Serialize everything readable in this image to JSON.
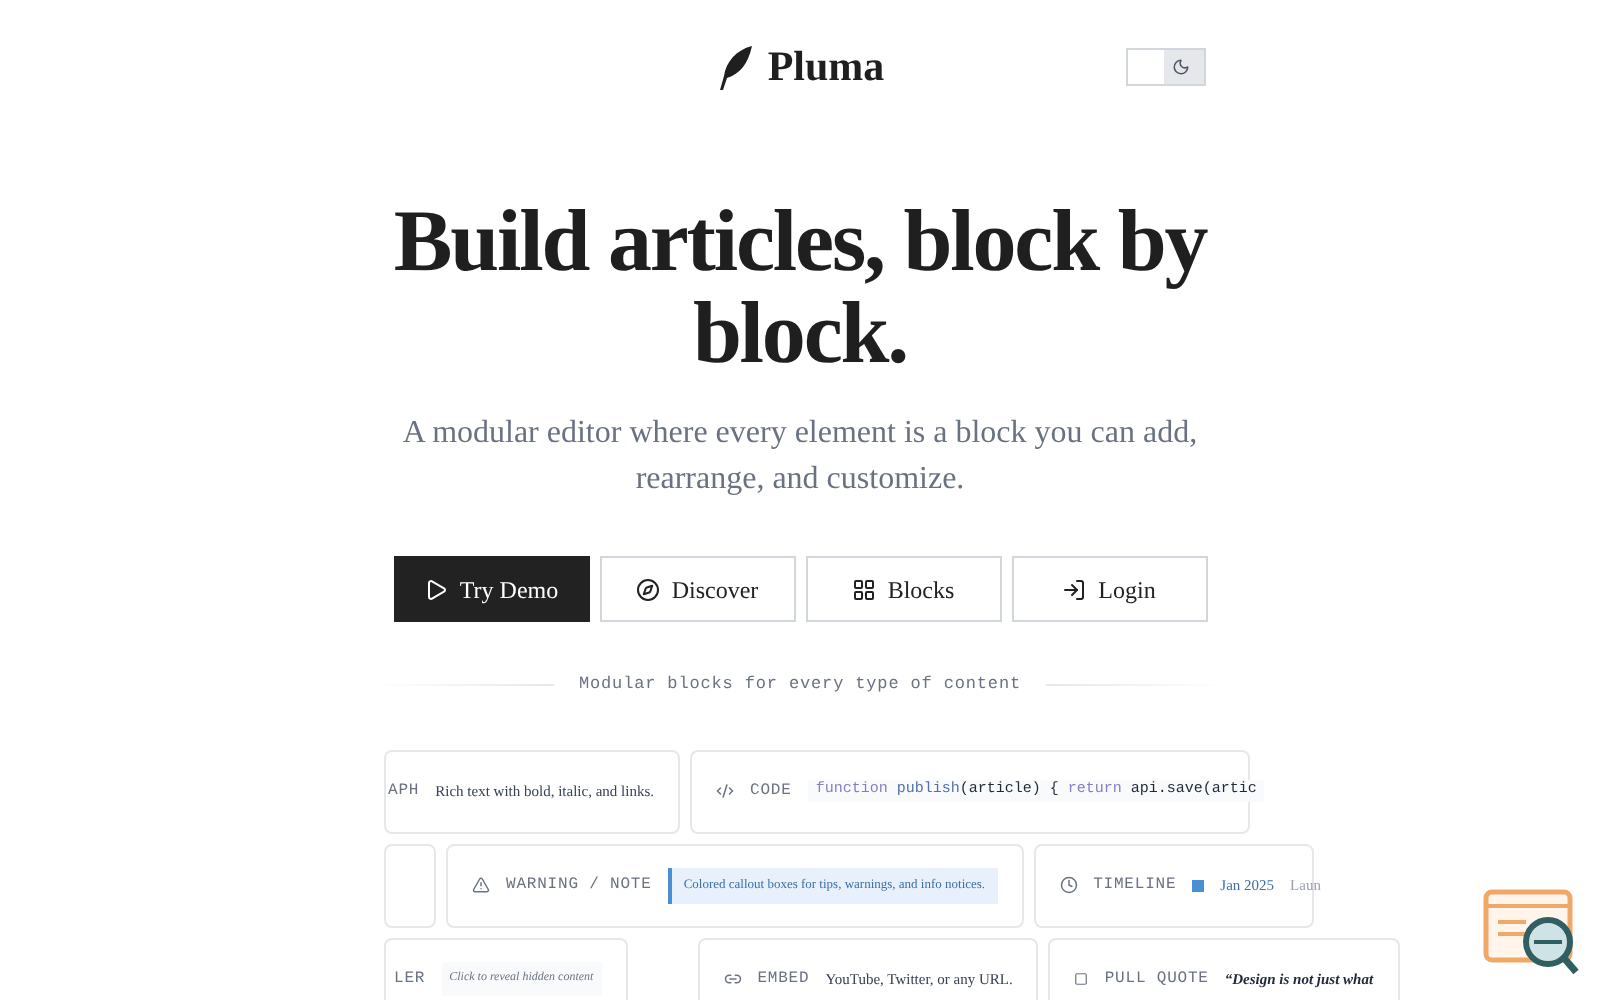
{
  "header": {
    "brand": "Pluma",
    "theme_toggle": {
      "dark": false
    }
  },
  "hero": {
    "title": "Build articles, block by block.",
    "subtitle": "A modular editor where every element is a block you can add, rearrange, and customize."
  },
  "actions": [
    {
      "label": "Try Demo",
      "primary": true
    },
    {
      "label": "Discover",
      "primary": false
    },
    {
      "label": "Blocks",
      "primary": false
    },
    {
      "label": "Login",
      "primary": false
    }
  ],
  "divider_caption": "Modular blocks for every type of content",
  "block_rows": [
    [
      {
        "kind": "paragraph",
        "label": "APH",
        "text": "Rich text with bold, italic, and links."
      },
      {
        "kind": "code",
        "label": "CODE",
        "keyword": "function",
        "name": "publish",
        "args": "(article) {",
        "ret": "return",
        "call": "api.save(artic"
      }
    ],
    [
      {
        "kind": "blank"
      },
      {
        "kind": "callout",
        "label": "WARNING / NOTE",
        "text": "Colored callout boxes for tips, warnings, and info notices."
      },
      {
        "kind": "timeline",
        "label": "TIMELINE",
        "date": "Jan 2025",
        "text": "Laun"
      }
    ],
    [
      {
        "kind": "spoiler",
        "label": "LER",
        "text": "Click to reveal hidden content"
      },
      {
        "kind": "embed",
        "label": "EMBED",
        "text": "YouTube, Twitter, or any URL."
      },
      {
        "kind": "quote",
        "label": "PULL QUOTE",
        "text": "“Design is not just what"
      }
    ]
  ]
}
